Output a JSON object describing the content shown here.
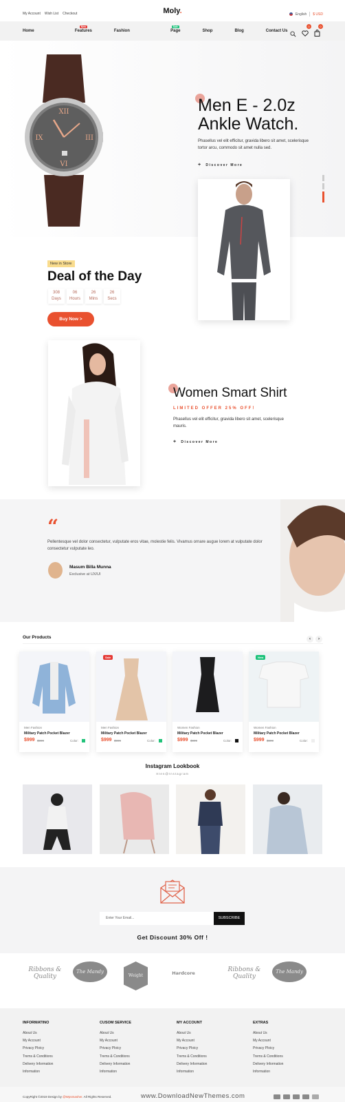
{
  "header": {
    "top_links": [
      "My Account",
      "Wish List",
      "Checkout"
    ],
    "logo": "Moly",
    "logo_dot": ".",
    "language": "English",
    "currency": "$ USD"
  },
  "nav": {
    "items": [
      {
        "label": "Home"
      },
      {
        "label": "Features",
        "badge": "New",
        "badge_color": "#e53935"
      },
      {
        "label": "Fashion"
      },
      {
        "label": "Page",
        "badge": "Sale",
        "badge_color": "#1cc27a"
      },
      {
        "label": "Shop"
      },
      {
        "label": "Blog"
      },
      {
        "label": "Contact Us"
      }
    ],
    "wishlist_count": "0",
    "cart_count": "0"
  },
  "hero": {
    "title_line1": "Men E - 2.0z",
    "title_line2": "Ankle Watch.",
    "description": "Phasellus vel elit efficitur, gravida libero sit amet, scelerisque tortor arcu, commodo sit amet nulla sed.",
    "cta": "Discover More",
    "slider_dots": 3,
    "active_dot": 3
  },
  "deal": {
    "badge": "New in Store",
    "title": "Deal of the Day",
    "countdown": [
      {
        "value": "308",
        "unit": "Days"
      },
      {
        "value": "06",
        "unit": "Hours"
      },
      {
        "value": "26",
        "unit": "Mins"
      },
      {
        "value": "26",
        "unit": "Secs"
      }
    ],
    "button": "Buy Now >"
  },
  "shirt": {
    "title": "Women Smart Shirt",
    "subtitle": "LIMITED OFFER 25% OFF!",
    "description": "Phasellus vel elit efficitur, gravida libero sit amet, scelerisque mauris.",
    "cta": "Discover More"
  },
  "testimonial": {
    "quote": "Pellentesque vel dolor consectetur, vulputate eros vitae, molestie felis. Vivamus ornare augue lorem at vulputate dolor consectetur vulputate leo.",
    "name": "Masum Billa Munna",
    "role": "Exclusive at UX/UI"
  },
  "products": {
    "title": "Our Products",
    "items": [
      {
        "category": "Men Fashion",
        "name": "Military Patch Pocket Blazer",
        "price": "$999",
        "old_price": "$999",
        "color_label": "Color:",
        "color": "#22c27a",
        "tag": ""
      },
      {
        "category": "Men Fashion",
        "name": "Military Patch Pocket Blazer",
        "price": "$999",
        "old_price": "$999",
        "color_label": "Color:",
        "color": "#22c27a",
        "tag": "Sale",
        "tag_color": "#e53935"
      },
      {
        "category": "Women Fashion",
        "name": "Military Patch Pocket Blazer",
        "price": "$999",
        "old_price": "$999",
        "color_label": "Color:",
        "color": "#111111",
        "tag": ""
      },
      {
        "category": "Women Fashion",
        "name": "Military Patch Pocket Blazer",
        "price": "$999",
        "old_price": "$999",
        "color_label": "Color:",
        "color": "#eeeeee",
        "tag": "New",
        "tag_color": "#1cc27a"
      }
    ]
  },
  "instagram": {
    "title": "Instagram Lookbook",
    "subtitle": "Xten@Instagram"
  },
  "newsletter": {
    "placeholder": "Enter Your Email...",
    "button": "SUBSCRIBE",
    "discount": "Get Discount 30% Off !"
  },
  "brands": [
    "Ribbons & Quality",
    "The Mandy",
    "Weight",
    "Hardcore",
    "Ribbons & Quality",
    "The Mandy"
  ],
  "footer": {
    "columns": [
      {
        "title": "INFORMATINO",
        "links": [
          "About Us",
          "My Account",
          "Privacy Ploicy",
          "Trems & Conditions",
          "Delivery Information",
          "Information"
        ]
      },
      {
        "title": "CUSOM SERVICE",
        "links": [
          "About Us",
          "My Account",
          "Privacy Ploicy",
          "Trems & Conditions",
          "Delivery Information",
          "Information"
        ]
      },
      {
        "title": "MY ACCOUNT",
        "links": [
          "About Us",
          "My Account",
          "Privacy Ploicy",
          "Trems & Conditions",
          "Delivery Information",
          "Information"
        ]
      },
      {
        "title": "EXTRAS",
        "links": [
          "About Us",
          "My Account",
          "Privacy Ploicy",
          "Trems & Conditions",
          "Delivery Information",
          "Information"
        ]
      }
    ],
    "copyright_prefix": "CopyRight ©2019 Design by ",
    "copyright_author": "@Wpsmasher",
    "copyright_suffix": ". All Rights Reserved.",
    "watermark": "www.DownloadNewThemes.com",
    "payments": [
      "paypal",
      "stripe",
      "visa",
      "mastercard",
      "card"
    ]
  },
  "colors": {
    "accent": "#e9512f",
    "dark": "#111111"
  }
}
